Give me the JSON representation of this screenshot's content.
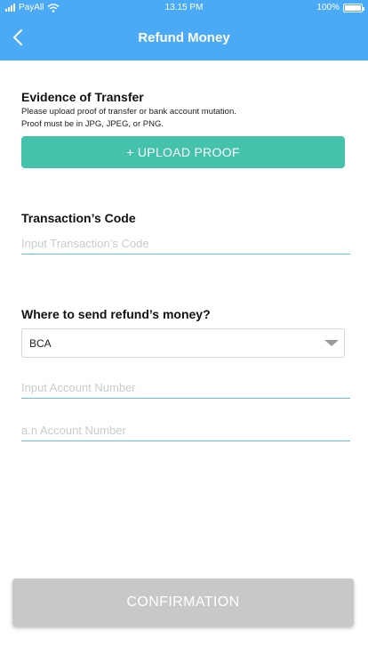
{
  "status_bar": {
    "carrier": "PayAll",
    "time": "13.15 PM",
    "battery_text": "100%",
    "battery_level": 1.0
  },
  "header": {
    "title": "Refund Money",
    "back_icon": "chevron-left-icon",
    "background": "#4aaaf6"
  },
  "evidence": {
    "heading": "Evidence of Transfer",
    "helper_line1": "Please upload proof of transfer or bank account mutation.",
    "helper_line2": "Proof must be in JPG, JPEG, or PNG.",
    "upload_label": "+ UPLOAD PROOF",
    "upload_color": "#44c2ac"
  },
  "transaction": {
    "heading": "Transaction’s Code",
    "placeholder": "Input Transaction’s Code"
  },
  "refund_destination": {
    "heading": "Where to send refund’s money?",
    "selected_bank": "BCA",
    "account_number_placeholder": "Input Account Number",
    "account_name_placeholder": "a.n Account Number"
  },
  "confirm": {
    "label": "CONFIRMATION",
    "color": "#c8c8c8"
  }
}
